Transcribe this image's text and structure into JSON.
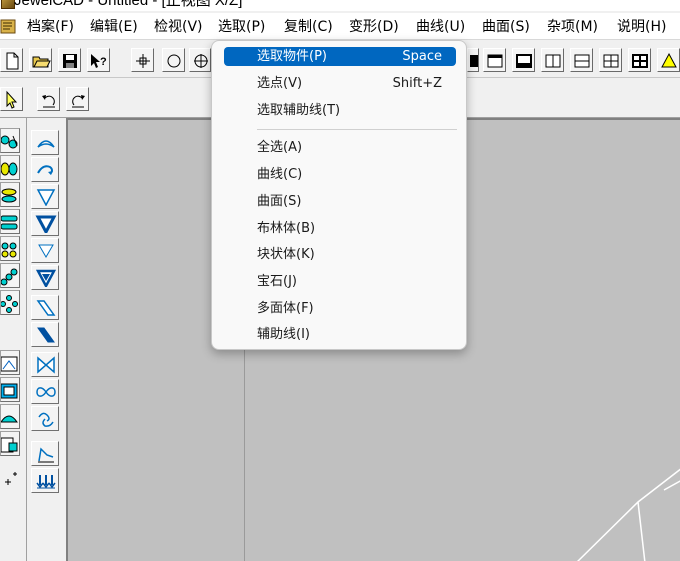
{
  "window": {
    "title": "JewelCAD - Untitled - [正视图 X/Z]"
  },
  "menubar": {
    "items": [
      {
        "label": "档案(F)"
      },
      {
        "label": "编辑(E)"
      },
      {
        "label": "检视(V)"
      },
      {
        "label": "选取(P)"
      },
      {
        "label": "复制(C)"
      },
      {
        "label": "变形(D)"
      },
      {
        "label": "曲线(U)"
      },
      {
        "label": "曲面(S)"
      },
      {
        "label": "杂项(M)"
      },
      {
        "label": "说明(H)"
      }
    ]
  },
  "dropdown": {
    "items": [
      {
        "label": "选取物件(P)",
        "shortcut": "Space"
      },
      {
        "label": "选点(V)",
        "shortcut": "Shift+Z"
      },
      {
        "label": "选取辅助线(T)",
        "shortcut": ""
      },
      {
        "label": "全选(A)",
        "shortcut": ""
      },
      {
        "label": "曲线(C)",
        "shortcut": ""
      },
      {
        "label": "曲面(S)",
        "shortcut": ""
      },
      {
        "label": "布林体(B)",
        "shortcut": ""
      },
      {
        "label": "块状体(K)",
        "shortcut": ""
      },
      {
        "label": "宝石(J)",
        "shortcut": ""
      },
      {
        "label": "多面体(F)",
        "shortcut": ""
      },
      {
        "label": "辅助线(I)",
        "shortcut": ""
      }
    ]
  },
  "toolbar": {
    "icons": [
      "new-file-icon",
      "open-folder-icon",
      "save-icon",
      "help-pointer-icon",
      "crosshair-icon",
      "circle-icon",
      "target-icon"
    ],
    "right_icons": [
      "view-single-icon",
      "view-top-icon",
      "view-bottom-icon",
      "view-split-v-icon",
      "view-split-h-icon",
      "view-quad-icon",
      "view-quad-bold-icon",
      "render-icon"
    ]
  },
  "colors": {
    "accent": "#0067c0",
    "viewport": "#c0c0c0"
  }
}
